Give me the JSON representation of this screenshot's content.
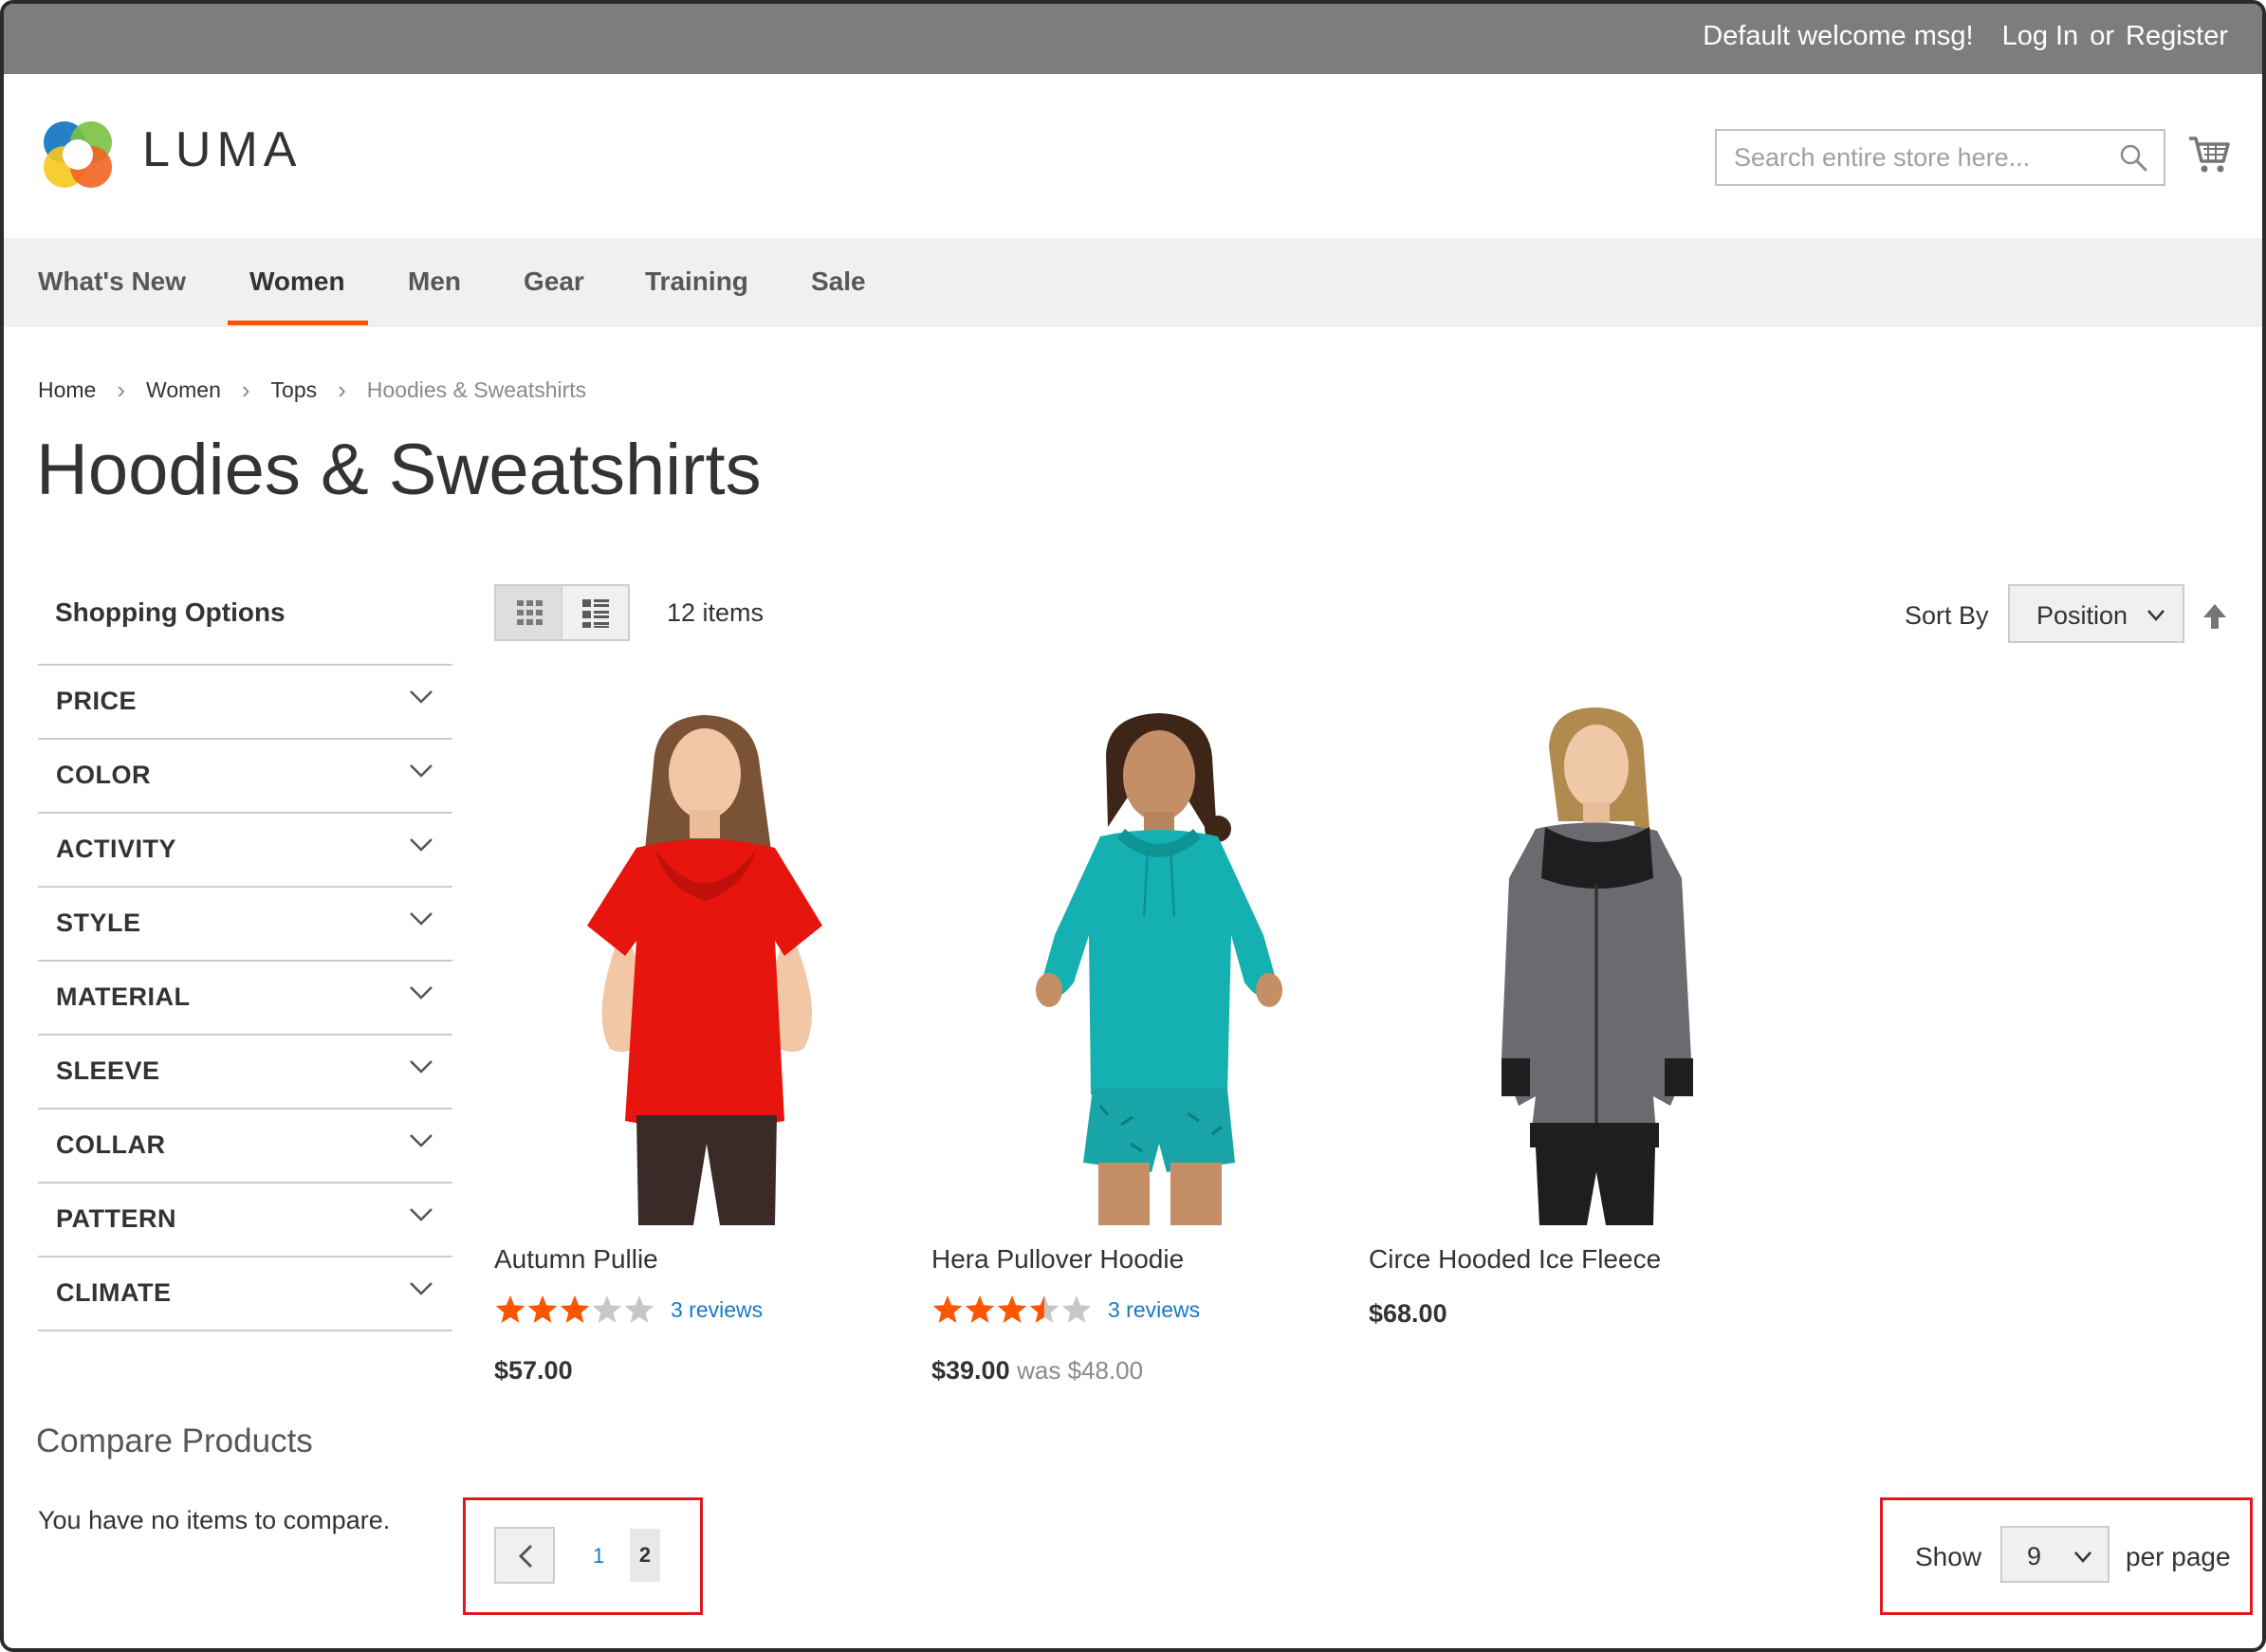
{
  "header_panel": {
    "welcome": "Default welcome msg!",
    "login": "Log In",
    "or": "or",
    "register": "Register"
  },
  "logo": {
    "text": "LUMA"
  },
  "search": {
    "placeholder": "Search entire store here..."
  },
  "nav": {
    "items": [
      "What's New",
      "Women",
      "Men",
      "Gear",
      "Training",
      "Sale"
    ],
    "active": "Women"
  },
  "breadcrumbs": [
    "Home",
    "Women",
    "Tops",
    "Hoodies & Sweatshirts"
  ],
  "page_title": "Hoodies & Sweatshirts",
  "sidebar": {
    "title": "Shopping Options",
    "filters": [
      "PRICE",
      "COLOR",
      "ACTIVITY",
      "STYLE",
      "MATERIAL",
      "SLEEVE",
      "COLLAR",
      "PATTERN",
      "CLIMATE"
    ],
    "compare_title": "Compare Products",
    "compare_empty": "You have no items to compare."
  },
  "toolbar": {
    "items_count": "12 items",
    "sort_label": "Sort By",
    "sort_value": "Position"
  },
  "products": [
    {
      "name": "Autumn Pullie",
      "rating": 3,
      "reviews": "3 reviews",
      "price": "$57.00",
      "was": ""
    },
    {
      "name": "Hera Pullover Hoodie",
      "rating": 3.5,
      "reviews": "3 reviews",
      "price": "$39.00",
      "was": "was $48.00"
    },
    {
      "name": "Circe Hooded Ice Fleece",
      "rating": null,
      "reviews": "",
      "price": "$68.00",
      "was": ""
    }
  ],
  "pager": {
    "pages": [
      "1",
      "2"
    ],
    "current": "2"
  },
  "limiter": {
    "show": "Show",
    "value": "9",
    "per_page": "per page"
  },
  "colors": {
    "accent": "#ff5501",
    "link": "#1979c3",
    "star": "#ff5501",
    "star_empty": "#c7c7c7",
    "highlight_box": "#e0191f",
    "top_bar": "#7d7d7d",
    "nav_bg": "#f0f0f0"
  }
}
